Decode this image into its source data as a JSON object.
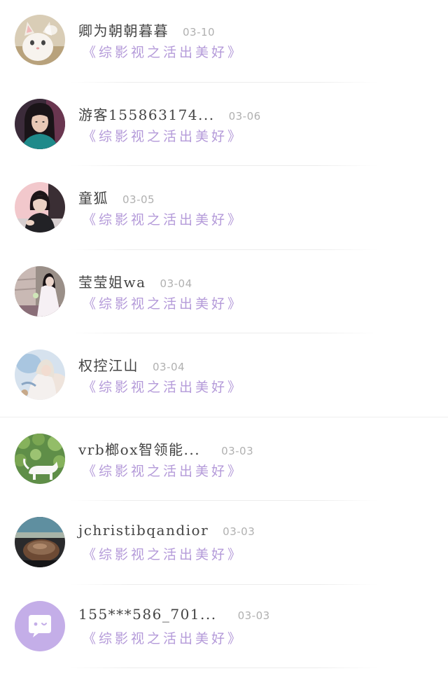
{
  "comments": [
    {
      "name": "卿为朝朝暮暮",
      "date": "03-10",
      "book": "《综影视之活出美好》",
      "avatar": "cat-avatar-icon"
    },
    {
      "name": "游客155863174...",
      "date": "03-06",
      "book": "《综影视之活出美好》",
      "avatar": "girl-portrait-avatar"
    },
    {
      "name": "童狐",
      "date": "03-05",
      "book": "《综影视之活出美好》",
      "avatar": "girl-sitting-avatar"
    },
    {
      "name": "莹莹姐wa",
      "date": "03-04",
      "book": "《综影视之活出美好》",
      "avatar": "girl-white-dress-avatar"
    },
    {
      "name": "权控江山",
      "date": "03-04",
      "book": "《综影视之活出美好》",
      "avatar": "anime-art-avatar"
    },
    {
      "name": "vrb榔ox智领能...",
      "date": "03-03",
      "book": "《综影视之活出美好》",
      "avatar": "white-cat-leaves-avatar"
    },
    {
      "name": "jchristibqandior",
      "date": "03-03",
      "book": "《综影视之活出美好》",
      "avatar": "dark-shell-avatar"
    },
    {
      "name": "155***586_701...",
      "date": "03-03",
      "book": "《综影视之活出美好》",
      "avatar": "chat-bubble-avatar"
    }
  ],
  "colors": {
    "name": "#444444",
    "date": "#b0b0b0",
    "book": "#b49ad9",
    "default_avatar_bg": "#c4aee8"
  }
}
